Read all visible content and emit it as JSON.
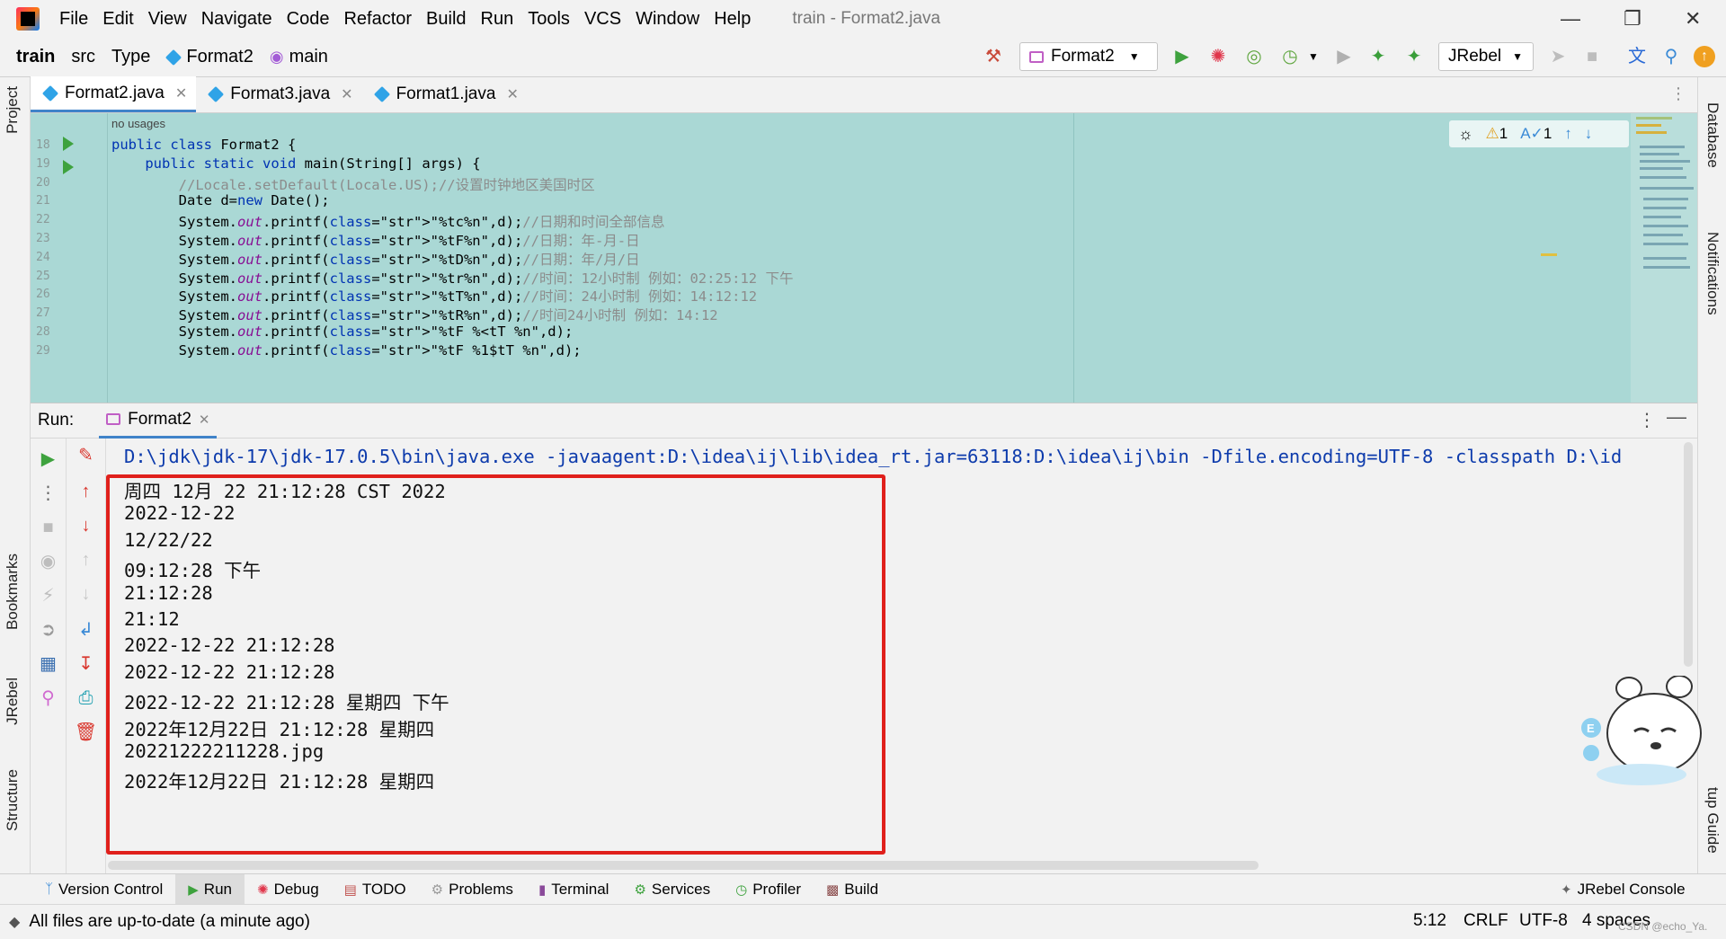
{
  "menubar": {
    "items": [
      "File",
      "Edit",
      "View",
      "Navigate",
      "Code",
      "Refactor",
      "Build",
      "Run",
      "Tools",
      "VCS",
      "Window",
      "Help"
    ],
    "window_title": "train - Format2.java"
  },
  "navbar": {
    "project": "train",
    "src": "src",
    "type": "Type",
    "class": "Format2",
    "method": "main",
    "run_config": "Format2",
    "jrebel_select": "JRebel"
  },
  "left_strip": {
    "project": "Project",
    "bookmarks": "Bookmarks",
    "jrebel": "JRebel",
    "structure": "Structure"
  },
  "right_strip": {
    "database": "Database",
    "notifications": "Notifications",
    "setup_guide": "tup Guide"
  },
  "editor_tabs": [
    "Format2.java",
    "Format3.java",
    "Format1.java"
  ],
  "editor": {
    "usages": "no usages",
    "inspection": {
      "warnings": "1",
      "typos": "1"
    },
    "lines": [
      {
        "num": "18",
        "code": "public class Format2 {"
      },
      {
        "num": "19",
        "code": "    public static void main(String[] args) {"
      },
      {
        "num": "20",
        "code": "        //Locale.setDefault(Locale.US);//设置时钟地区美国时区"
      },
      {
        "num": "21",
        "code": "        Date d=new Date();"
      },
      {
        "num": "22",
        "code": "        System.out.printf(\"%tc%n\",d);//日期和时间全部信息"
      },
      {
        "num": "23",
        "code": "        System.out.printf(\"%tF%n\",d);//日期：年-月-日"
      },
      {
        "num": "24",
        "code": "        System.out.printf(\"%tD%n\",d);//日期：年/月/日"
      },
      {
        "num": "25",
        "code": "        System.out.printf(\"%tr%n\",d);//时间：12小时制 例如：02:25:12 下午"
      },
      {
        "num": "26",
        "code": "        System.out.printf(\"%tT%n\",d);//时间：24小时制 例如：14:12:12"
      },
      {
        "num": "27",
        "code": "        System.out.printf(\"%tR%n\",d);//时间24小时制 例如：14:12"
      },
      {
        "num": "28",
        "code": "        System.out.printf(\"%tF %<tT %n\",d);"
      },
      {
        "num": "29",
        "code": "        System.out.printf(\"%tF %1$tT %n\",d);"
      }
    ]
  },
  "run_panel": {
    "label": "Run:",
    "tab": "Format2",
    "command": "D:\\jdk\\jdk-17\\jdk-17.0.5\\bin\\java.exe -javaagent:D:\\idea\\ij\\lib\\idea_rt.jar=63118:D:\\idea\\ij\\bin -Dfile.encoding=UTF-8 -classpath D:\\id",
    "output": [
      "周四 12月 22 21:12:28 CST 2022",
      "2022-12-22",
      "12/22/22",
      "09:12:28 下午",
      "21:12:28",
      "21:12",
      "2022-12-22 21:12:28",
      "2022-12-22 21:12:28",
      "2022-12-22 21:12:28 星期四 下午",
      "2022年12月22日 21:12:28 星期四",
      "20221222211228.jpg",
      "2022年12月22日 21:12:28 星期四"
    ]
  },
  "tool_tabs": [
    "Version Control",
    "Run",
    "Debug",
    "TODO",
    "Problems",
    "Terminal",
    "Services",
    "Profiler",
    "Build"
  ],
  "jrebel_console": "JRebel Console",
  "status": {
    "message": "All files are up-to-date (a minute ago)",
    "position": "5:12",
    "line_sep": "CRLF",
    "encoding": "UTF-8",
    "indent": "4 spaces"
  },
  "watermark": "CSDN @echo_Ya."
}
